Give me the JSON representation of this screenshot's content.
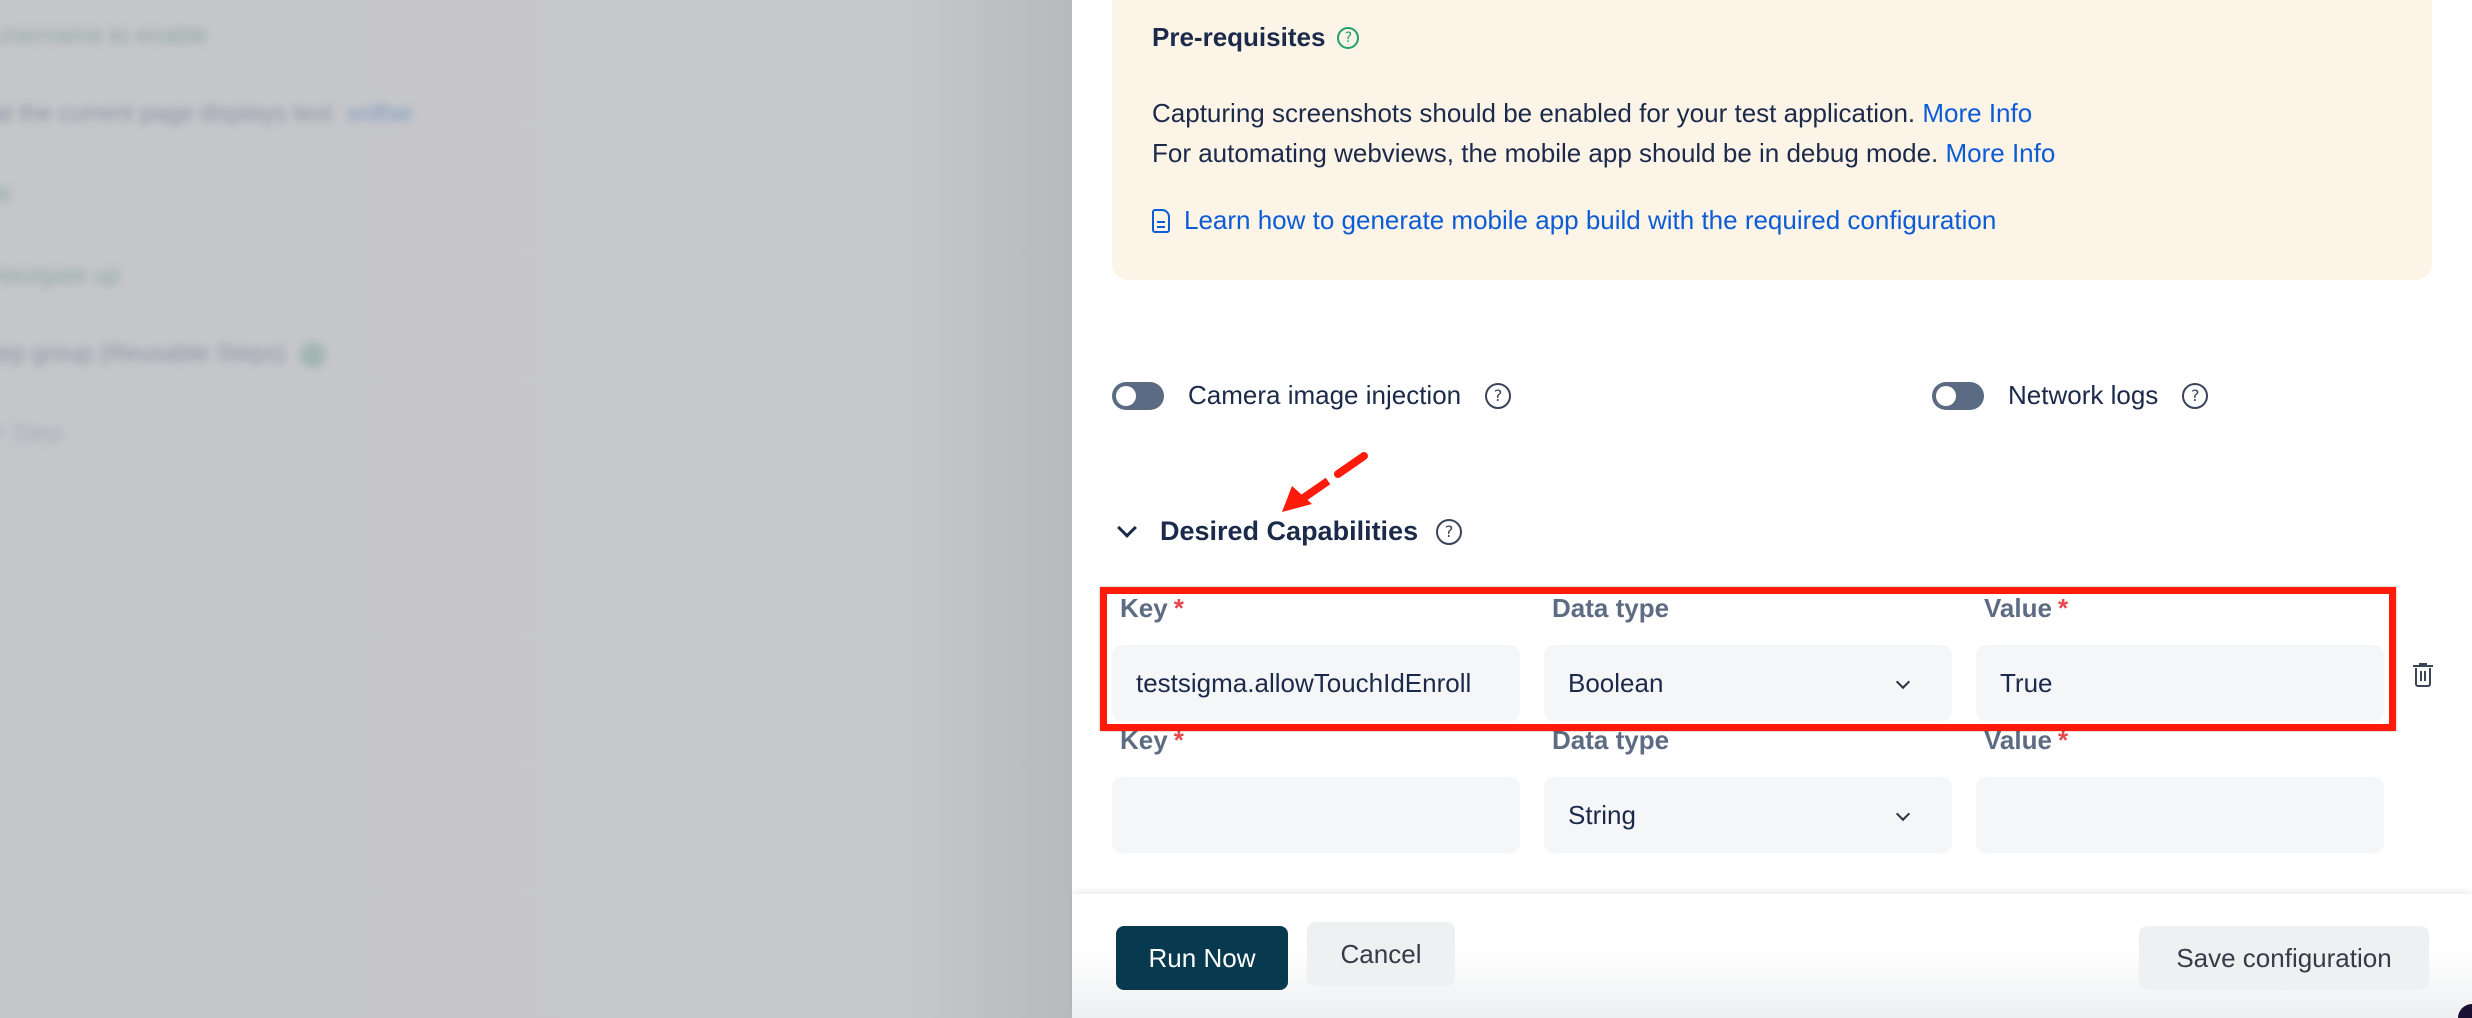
{
  "background": {
    "lines": [
      {
        "text": "Username to enable",
        "tone": "green"
      },
      {
        "text": "at the current page displays text",
        "link": "xrdfse",
        "tone": "gray"
      },
      {
        "text": "le",
        "tone": "green"
      },
      {
        "text": "Navigate up",
        "tone": "green"
      },
      {
        "text": "tep group (Reusable Steps)",
        "tone": "gray"
      },
      {
        "text": "+ Step",
        "tone": "gray"
      }
    ]
  },
  "prerequisites": {
    "title": "Pre-requisites",
    "line1": "Capturing screenshots should be enabled for your test application.",
    "line1_link": "More Info",
    "line2": "For automating webviews, the mobile app should be in debug mode.",
    "line2_link": "More Info",
    "learn_link": "Learn how to generate mobile app build with the required configuration"
  },
  "toggles": {
    "camera": {
      "label": "Camera image injection",
      "enabled": false
    },
    "network": {
      "label": "Network logs",
      "enabled": false
    }
  },
  "desired_capabilities": {
    "title": "Desired Capabilities",
    "expanded": true,
    "labels": {
      "key": "Key",
      "data_type": "Data type",
      "value": "Value",
      "required_mark": "*"
    },
    "rows": [
      {
        "key": "testsigma.allowTouchIdEnroll",
        "data_type": "Boolean",
        "value": "True"
      },
      {
        "key": "",
        "data_type": "String",
        "value": ""
      }
    ]
  },
  "footer": {
    "run_now": "Run Now",
    "cancel": "Cancel",
    "save_configuration": "Save configuration"
  },
  "colors": {
    "primary": "#083a4f",
    "link": "#0b5cd5",
    "annotation": "#ff1a0a",
    "prereq_bg": "#fdf4e8"
  }
}
